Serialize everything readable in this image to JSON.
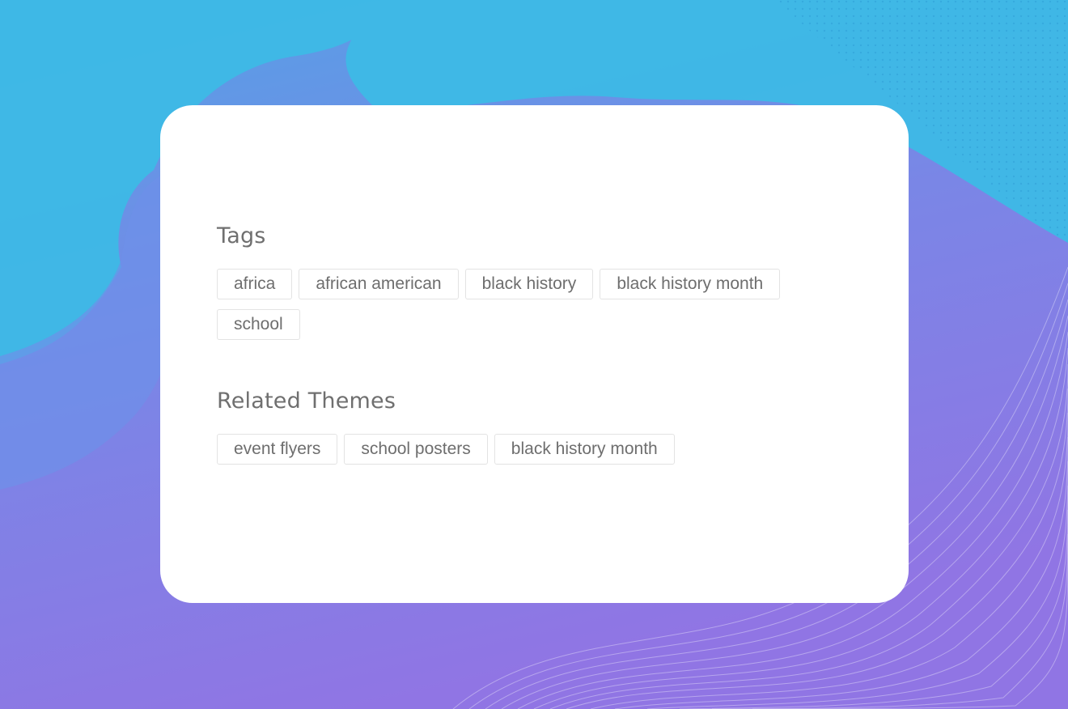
{
  "background": {
    "gradient_top": "#4aa6e6",
    "gradient_bottom": "#8b78e6",
    "blob_color": "#3ab8e6"
  },
  "tags_section": {
    "title": "Tags",
    "items": [
      "africa",
      "african american",
      "black history",
      "black history month",
      "school"
    ]
  },
  "themes_section": {
    "title": "Related Themes",
    "items": [
      "event flyers",
      "school posters",
      "black history month"
    ]
  }
}
